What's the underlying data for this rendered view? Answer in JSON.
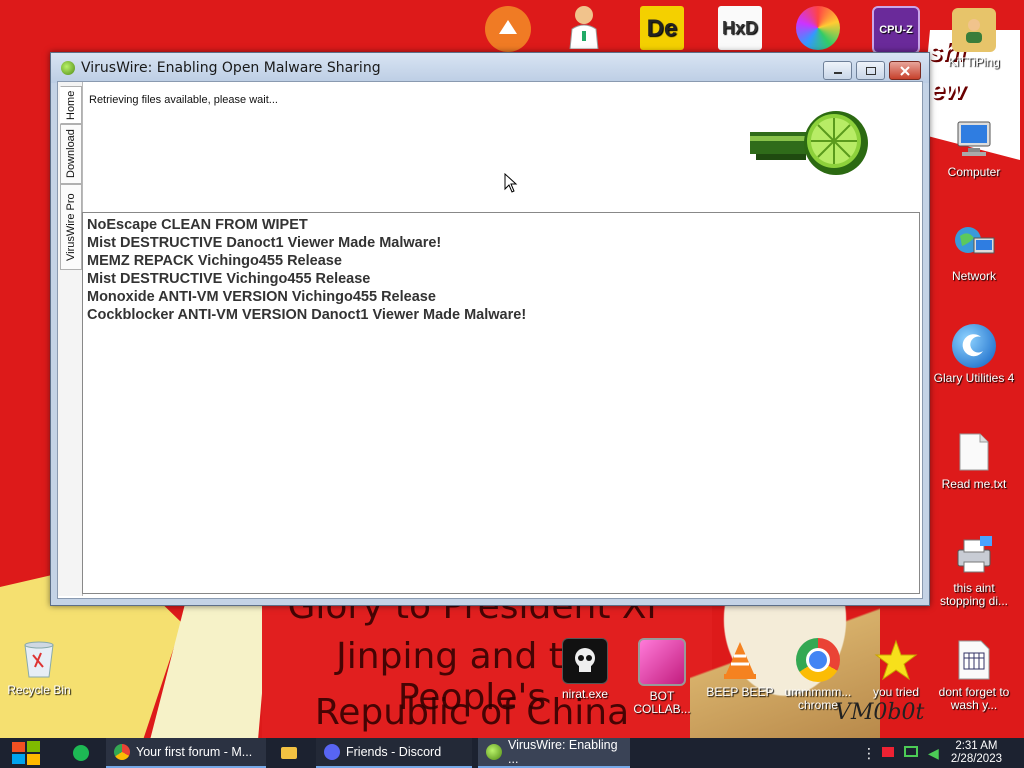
{
  "window": {
    "title": "VirusWire: Enabling Open Malware Sharing",
    "tabs": [
      "Home",
      "Download",
      "VirusWire Pro"
    ],
    "status": "Retrieving files available, please wait...",
    "files": [
      "NoEscape CLEAN FROM WIPET",
      "Mist DESTRUCTIVE Danoct1 Viewer Made Malware!",
      "MEMZ REPACK Vichingo455 Release",
      "Mist DESTRUCTIVE Vichingo455 Release",
      "Monoxide ANTI-VM VERSION Vichingo455 Release",
      "Cockblocker ANTI-VM VERSION Danoct1 Viewer Made Malware!"
    ]
  },
  "desktop": {
    "right_icons": [
      {
        "label": "KiTTiPing",
        "icon": "user-folder-icon"
      },
      {
        "label": "Computer",
        "icon": "computer-icon"
      },
      {
        "label": "Network",
        "icon": "network-icon"
      },
      {
        "label": "Glary Utilities 4",
        "icon": "glary-icon"
      },
      {
        "label": "Read me.txt",
        "icon": "text-file-icon"
      },
      {
        "label": "this aint stopping di...",
        "icon": "printer-icon"
      }
    ],
    "bottom_icons": [
      {
        "label": "Recycle Bin",
        "icon": "recycle-bin-icon"
      },
      {
        "label": "nirat.exe",
        "icon": "skull-icon"
      },
      {
        "label": "BOT COLLAB...",
        "icon": "monitor-icon"
      },
      {
        "label": "BEEP BEEP",
        "icon": "vlc-icon"
      },
      {
        "label": "ummmmm... chrome",
        "icon": "chrome-icon"
      },
      {
        "label": "you tried",
        "icon": "star-icon"
      },
      {
        "label": "dont forget to wash y...",
        "icon": "calendar-file-icon"
      }
    ],
    "top_icon_labels": [
      "De",
      "HxD",
      "CPU-Z"
    ],
    "wallpaper_text": [
      "Glory to President Xi",
      "Jinping and the People's",
      "Republic of China"
    ],
    "wallpaper_signature": "VM0b0t"
  },
  "taskbar": {
    "items": [
      {
        "label": "Your first forum - M...",
        "color": "#e8b62a"
      },
      {
        "label": "Friends - Discord",
        "color": "#5865f2"
      },
      {
        "label": "VirusWire: Enabling ...",
        "color": "#7fc23a"
      }
    ],
    "time": "2:31 AM",
    "date": "2/28/2023"
  },
  "colors": {
    "accent": "#76a9e8",
    "wallpaper": "#dd1a1a"
  }
}
